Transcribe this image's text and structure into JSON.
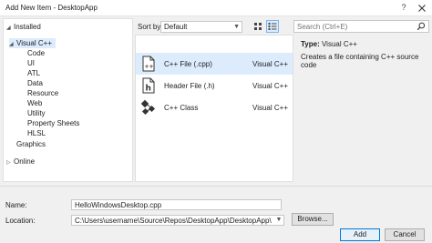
{
  "window": {
    "title": "Add New Item - DesktopApp",
    "help_label": "?"
  },
  "tree": {
    "installed": "Installed",
    "visual_cpp": "Visual C++",
    "children": [
      "Code",
      "UI",
      "ATL",
      "Data",
      "Resource",
      "Web",
      "Utility",
      "Property Sheets",
      "HLSL"
    ],
    "graphics": "Graphics",
    "online": "Online"
  },
  "sort": {
    "label": "Sort by:",
    "value": "Default"
  },
  "items": [
    {
      "name": "C++ File (.cpp)",
      "lang": "Visual C++",
      "icon": "cpp-file-icon"
    },
    {
      "name": "Header File (.h)",
      "lang": "Visual C++",
      "icon": "header-file-icon"
    },
    {
      "name": "C++ Class",
      "lang": "Visual C++",
      "icon": "cpp-class-icon"
    }
  ],
  "search": {
    "placeholder": "Search (Ctrl+E)"
  },
  "details": {
    "type_label": "Type:",
    "type_value": "Visual C++",
    "description": "Creates a file containing C++ source code"
  },
  "name_field": {
    "label": "Name:",
    "value": "HelloWindowsDesktop.cpp"
  },
  "location_field": {
    "label": "Location:",
    "value": "C:\\Users\\username\\Source\\Repos\\DesktopApp\\DesktopApp\\"
  },
  "buttons": {
    "browse": "Browse...",
    "add": "Add",
    "cancel": "Cancel"
  },
  "colors": {
    "accent": "#0078d7",
    "selection": "#dcecfc"
  }
}
